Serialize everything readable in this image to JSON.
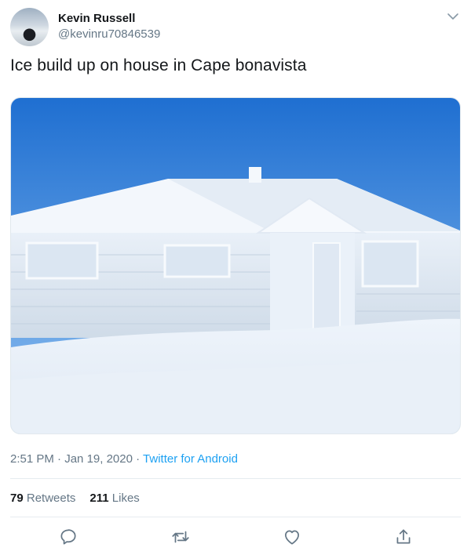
{
  "author": {
    "name": "Kevin Russell",
    "handle": "@kevinru70846539"
  },
  "tweet": {
    "text": "Ice build up on house in Cape bonavista"
  },
  "meta": {
    "time": "2:51 PM",
    "sep1": " · ",
    "date": "Jan 19, 2020",
    "sep2": " · ",
    "source": "Twitter for Android"
  },
  "stats": {
    "retweets_count": "79",
    "retweets_label": "Retweets",
    "likes_count": "211",
    "likes_label": "Likes"
  },
  "icons": {
    "menu": "chevron-down-icon",
    "reply": "reply-icon",
    "retweet": "retweet-icon",
    "like": "heart-icon",
    "share": "share-icon"
  },
  "colors": {
    "link": "#1da1f2",
    "secondary": "#657786",
    "text": "#14171a"
  }
}
